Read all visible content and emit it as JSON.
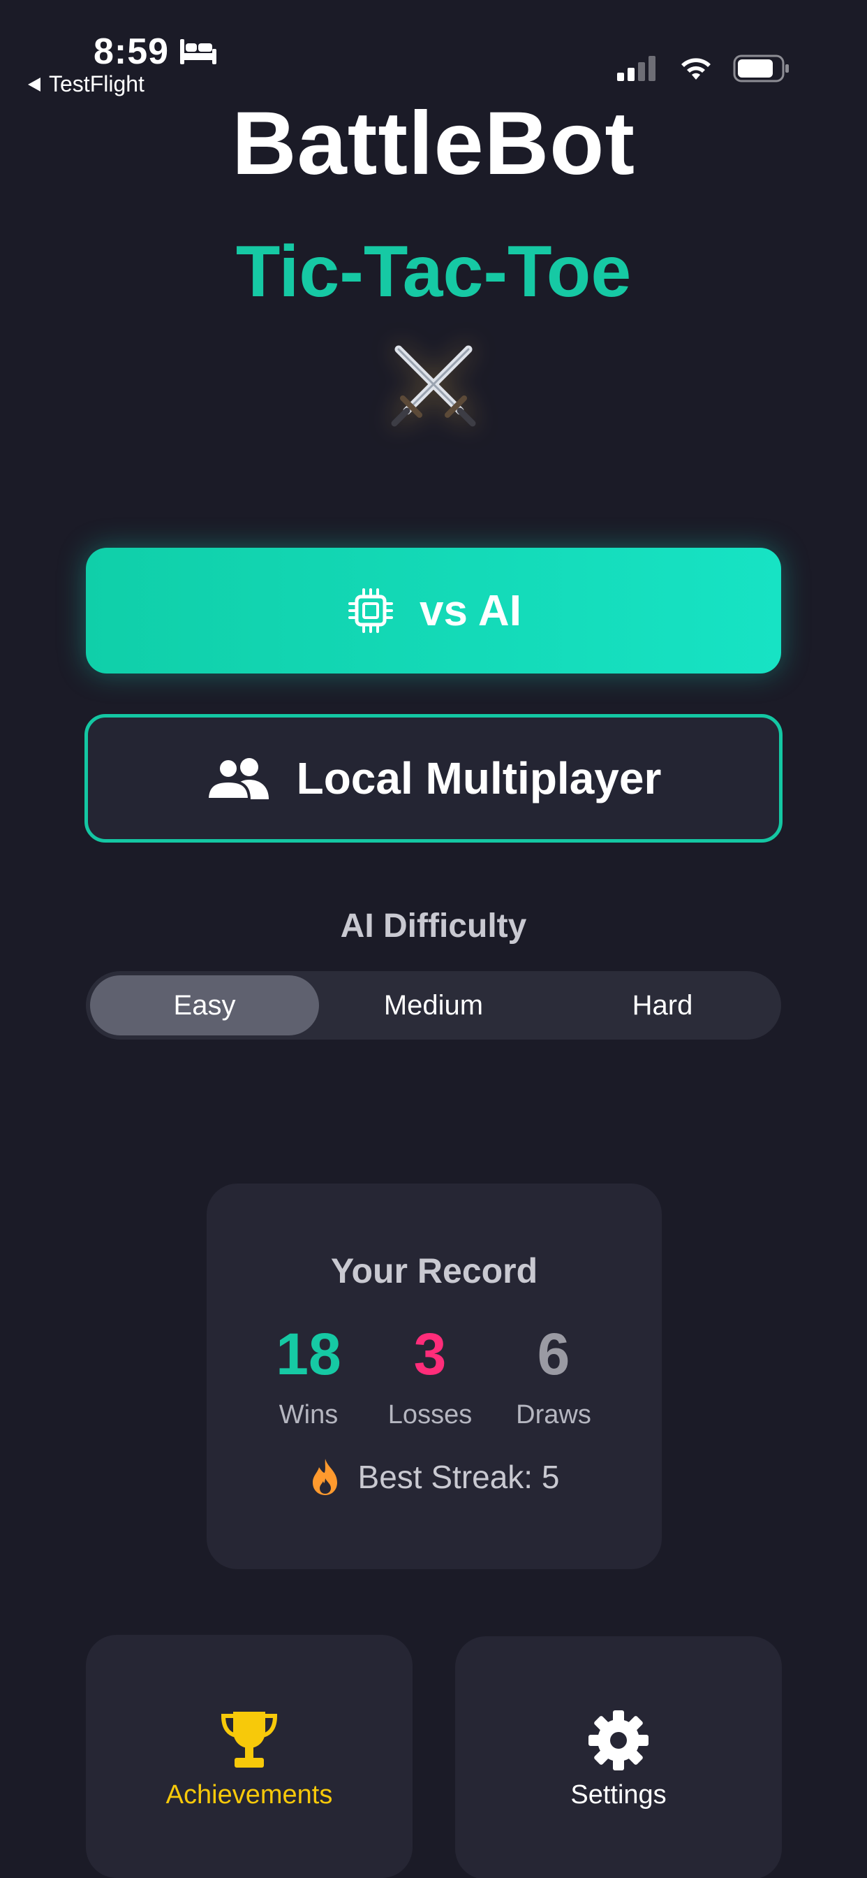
{
  "status_bar": {
    "time": "8:59",
    "back_app": "TestFlight"
  },
  "header": {
    "title": "BattleBot",
    "subtitle": "Tic-Tac-Toe",
    "emblem_icon": "crossed-swords-icon"
  },
  "colors": {
    "background": "#1b1b27",
    "accent": "#16c9a4",
    "card": "#262634",
    "wins": "#16c9a4",
    "losses": "#ff2d7a",
    "draws": "#9a9aa3",
    "achievements": "#f7c90a",
    "flame": "#ff9a2e"
  },
  "modes": {
    "vs_ai": {
      "label": "vs AI",
      "icon": "cpu-chip-icon"
    },
    "local": {
      "label": "Local Multiplayer",
      "icon": "people-icon"
    }
  },
  "difficulty": {
    "label": "AI Difficulty",
    "options": [
      "Easy",
      "Medium",
      "Hard"
    ],
    "selected": "Easy"
  },
  "record": {
    "title": "Your Record",
    "wins": {
      "value": "18",
      "label": "Wins"
    },
    "losses": {
      "value": "3",
      "label": "Losses"
    },
    "draws": {
      "value": "6",
      "label": "Draws"
    },
    "streak": "Best Streak: 5",
    "streak_icon": "flame-icon"
  },
  "bottom": {
    "achievements": {
      "label": "Achievements",
      "icon": "trophy-icon"
    },
    "settings": {
      "label": "Settings",
      "icon": "gear-icon"
    }
  }
}
